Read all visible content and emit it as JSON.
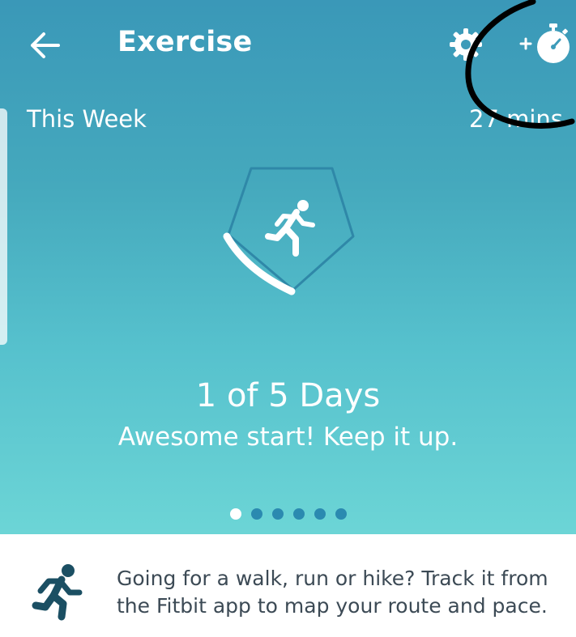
{
  "header": {
    "title": "Exercise",
    "back_icon": "arrow-left-icon",
    "settings_icon": "gear-icon",
    "add_timer_icon": "add-stopwatch-icon"
  },
  "week": {
    "label": "This Week",
    "value": "27 mins"
  },
  "goal": {
    "badge_icon": "running-figure-icon",
    "days_completed": 1,
    "days_goal": 5,
    "progress_text": "1 of 5 Days",
    "message": "Awesome start! Keep it up."
  },
  "pager": {
    "count": 6,
    "active_index": 0
  },
  "tip": {
    "icon": "runner-icon",
    "text": "Going for a walk, run or hike? Track it from the Fitbit app to map your route and pace."
  },
  "colors": {
    "gradient_top": "#3a98b8",
    "gradient_bottom": "#6cd5d6",
    "dot_inactive": "#2b8ab0",
    "runner_dark": "#1b4f63",
    "tip_text": "#3c4a55",
    "annotation": "#000000"
  }
}
